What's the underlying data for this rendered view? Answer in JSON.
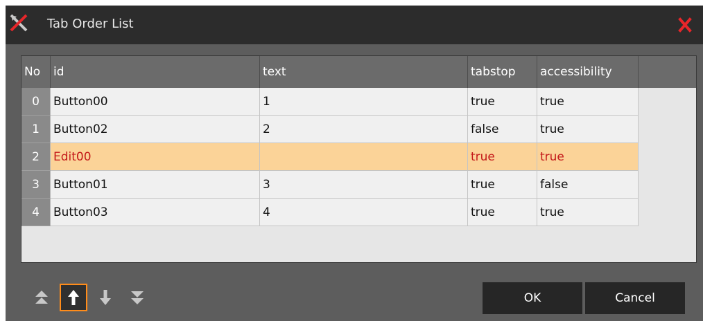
{
  "window": {
    "title": "Tab Order List"
  },
  "grid": {
    "columns": [
      "No",
      "id",
      "text",
      "tabstop",
      "accessibility"
    ],
    "rows": [
      {
        "no": "0",
        "id": "Button00",
        "text": "1",
        "tabstop": "true",
        "accessibility": "true",
        "selected": false
      },
      {
        "no": "1",
        "id": "Button02",
        "text": "2",
        "tabstop": "false",
        "accessibility": "true",
        "selected": false
      },
      {
        "no": "2",
        "id": "Edit00",
        "text": "",
        "tabstop": "true",
        "accessibility": "true",
        "selected": true
      },
      {
        "no": "3",
        "id": "Button01",
        "text": "3",
        "tabstop": "true",
        "accessibility": "false",
        "selected": false
      },
      {
        "no": "4",
        "id": "Button03",
        "text": "4",
        "tabstop": "true",
        "accessibility": "true",
        "selected": false
      }
    ]
  },
  "toolbar": {
    "move_buttons": [
      {
        "name": "move-to-top-icon",
        "active": false
      },
      {
        "name": "move-up-icon",
        "active": true
      },
      {
        "name": "move-down-icon",
        "active": false
      },
      {
        "name": "move-to-bottom-icon",
        "active": false
      }
    ]
  },
  "buttons": {
    "ok": "OK",
    "cancel": "Cancel"
  },
  "colors": {
    "titlebar": "#2c2c2c",
    "dialog": "#5d5d5d",
    "selected_row": "#fbd398",
    "selected_text": "#c41a1a",
    "active_border": "#ff8c1a",
    "close_icon": "#e8262a"
  }
}
